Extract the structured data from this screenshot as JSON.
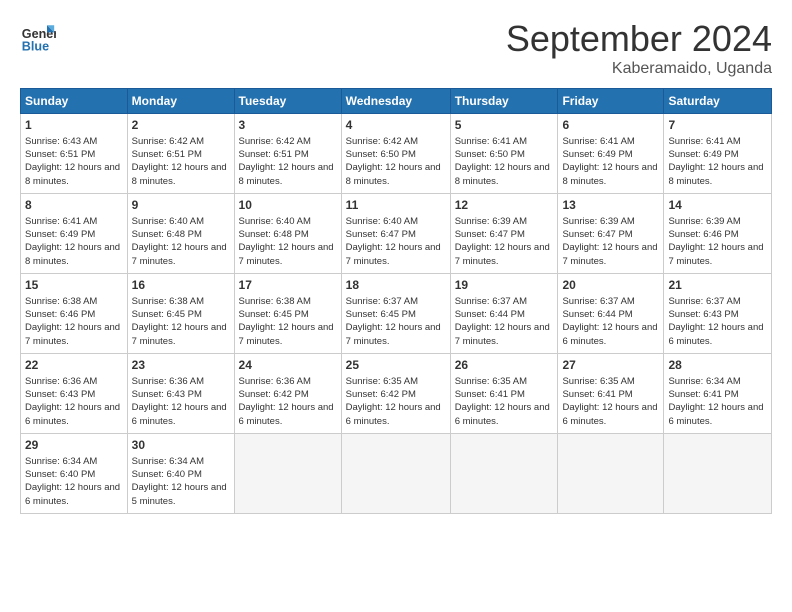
{
  "logo": {
    "line1": "General",
    "line2": "Blue"
  },
  "title": "September 2024",
  "subtitle": "Kaberamaido, Uganda",
  "days_header": [
    "Sunday",
    "Monday",
    "Tuesday",
    "Wednesday",
    "Thursday",
    "Friday",
    "Saturday"
  ],
  "weeks": [
    [
      {
        "day": "1",
        "sunrise": "6:43 AM",
        "sunset": "6:51 PM",
        "daylight": "12 hours and 8 minutes."
      },
      {
        "day": "2",
        "sunrise": "6:42 AM",
        "sunset": "6:51 PM",
        "daylight": "12 hours and 8 minutes."
      },
      {
        "day": "3",
        "sunrise": "6:42 AM",
        "sunset": "6:51 PM",
        "daylight": "12 hours and 8 minutes."
      },
      {
        "day": "4",
        "sunrise": "6:42 AM",
        "sunset": "6:50 PM",
        "daylight": "12 hours and 8 minutes."
      },
      {
        "day": "5",
        "sunrise": "6:41 AM",
        "sunset": "6:50 PM",
        "daylight": "12 hours and 8 minutes."
      },
      {
        "day": "6",
        "sunrise": "6:41 AM",
        "sunset": "6:49 PM",
        "daylight": "12 hours and 8 minutes."
      },
      {
        "day": "7",
        "sunrise": "6:41 AM",
        "sunset": "6:49 PM",
        "daylight": "12 hours and 8 minutes."
      }
    ],
    [
      {
        "day": "8",
        "sunrise": "6:41 AM",
        "sunset": "6:49 PM",
        "daylight": "12 hours and 8 minutes."
      },
      {
        "day": "9",
        "sunrise": "6:40 AM",
        "sunset": "6:48 PM",
        "daylight": "12 hours and 7 minutes."
      },
      {
        "day": "10",
        "sunrise": "6:40 AM",
        "sunset": "6:48 PM",
        "daylight": "12 hours and 7 minutes."
      },
      {
        "day": "11",
        "sunrise": "6:40 AM",
        "sunset": "6:47 PM",
        "daylight": "12 hours and 7 minutes."
      },
      {
        "day": "12",
        "sunrise": "6:39 AM",
        "sunset": "6:47 PM",
        "daylight": "12 hours and 7 minutes."
      },
      {
        "day": "13",
        "sunrise": "6:39 AM",
        "sunset": "6:47 PM",
        "daylight": "12 hours and 7 minutes."
      },
      {
        "day": "14",
        "sunrise": "6:39 AM",
        "sunset": "6:46 PM",
        "daylight": "12 hours and 7 minutes."
      }
    ],
    [
      {
        "day": "15",
        "sunrise": "6:38 AM",
        "sunset": "6:46 PM",
        "daylight": "12 hours and 7 minutes."
      },
      {
        "day": "16",
        "sunrise": "6:38 AM",
        "sunset": "6:45 PM",
        "daylight": "12 hours and 7 minutes."
      },
      {
        "day": "17",
        "sunrise": "6:38 AM",
        "sunset": "6:45 PM",
        "daylight": "12 hours and 7 minutes."
      },
      {
        "day": "18",
        "sunrise": "6:37 AM",
        "sunset": "6:45 PM",
        "daylight": "12 hours and 7 minutes."
      },
      {
        "day": "19",
        "sunrise": "6:37 AM",
        "sunset": "6:44 PM",
        "daylight": "12 hours and 7 minutes."
      },
      {
        "day": "20",
        "sunrise": "6:37 AM",
        "sunset": "6:44 PM",
        "daylight": "12 hours and 6 minutes."
      },
      {
        "day": "21",
        "sunrise": "6:37 AM",
        "sunset": "6:43 PM",
        "daylight": "12 hours and 6 minutes."
      }
    ],
    [
      {
        "day": "22",
        "sunrise": "6:36 AM",
        "sunset": "6:43 PM",
        "daylight": "12 hours and 6 minutes."
      },
      {
        "day": "23",
        "sunrise": "6:36 AM",
        "sunset": "6:43 PM",
        "daylight": "12 hours and 6 minutes."
      },
      {
        "day": "24",
        "sunrise": "6:36 AM",
        "sunset": "6:42 PM",
        "daylight": "12 hours and 6 minutes."
      },
      {
        "day": "25",
        "sunrise": "6:35 AM",
        "sunset": "6:42 PM",
        "daylight": "12 hours and 6 minutes."
      },
      {
        "day": "26",
        "sunrise": "6:35 AM",
        "sunset": "6:41 PM",
        "daylight": "12 hours and 6 minutes."
      },
      {
        "day": "27",
        "sunrise": "6:35 AM",
        "sunset": "6:41 PM",
        "daylight": "12 hours and 6 minutes."
      },
      {
        "day": "28",
        "sunrise": "6:34 AM",
        "sunset": "6:41 PM",
        "daylight": "12 hours and 6 minutes."
      }
    ],
    [
      {
        "day": "29",
        "sunrise": "6:34 AM",
        "sunset": "6:40 PM",
        "daylight": "12 hours and 6 minutes."
      },
      {
        "day": "30",
        "sunrise": "6:34 AM",
        "sunset": "6:40 PM",
        "daylight": "12 hours and 5 minutes."
      },
      null,
      null,
      null,
      null,
      null
    ]
  ]
}
